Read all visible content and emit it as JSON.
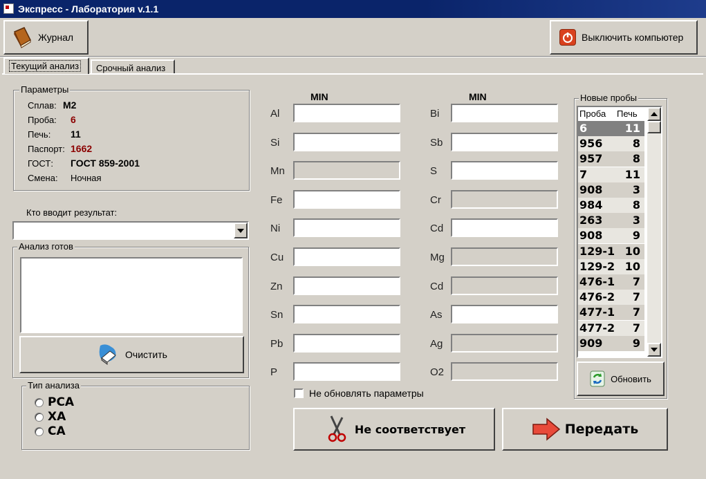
{
  "window": {
    "title": "Экспресс - Лаборатория v.1.1"
  },
  "toolbar": {
    "journal_label": "Журнал",
    "shutdown_label": "Выключить компьютер"
  },
  "tabs": {
    "current": "Текущий анализ",
    "urgent": "Срочный анализ"
  },
  "params": {
    "legend": "Параметры",
    "alloy_label": "Сплав:",
    "alloy_value": "М2",
    "sample_label": "Проба:",
    "sample_value": "6",
    "furnace_label": "Печь:",
    "furnace_value": "11",
    "passport_label": "Паспорт:",
    "passport_value": "1662",
    "gost_label": "ГОСТ:",
    "gost_value": "ГОСТ 859-2001",
    "shift_label": "Смена:",
    "shift_value": "Ночная",
    "accent_color": "#8b0000"
  },
  "operator": {
    "label": "Кто вводит результат:",
    "value": ""
  },
  "ready": {
    "legend": "Анализ готов",
    "text": "",
    "clear_label": "Очистить"
  },
  "analysis_type": {
    "legend": "Тип анализа",
    "options": [
      "РСА",
      "ХА",
      "СА"
    ]
  },
  "elements": {
    "min_header": "MIN",
    "left": [
      {
        "name": "Al",
        "value": "",
        "enabled": true
      },
      {
        "name": "Si",
        "value": "",
        "enabled": true
      },
      {
        "name": "Mn",
        "value": "",
        "enabled": false
      },
      {
        "name": "Fe",
        "value": "",
        "enabled": true
      },
      {
        "name": "Ni",
        "value": "",
        "enabled": true
      },
      {
        "name": "Cu",
        "value": "",
        "enabled": true
      },
      {
        "name": "Zn",
        "value": "",
        "enabled": true
      },
      {
        "name": "Sn",
        "value": "",
        "enabled": true
      },
      {
        "name": "Pb",
        "value": "",
        "enabled": true
      },
      {
        "name": "P",
        "value": "",
        "enabled": true
      }
    ],
    "right": [
      {
        "name": "Bi",
        "value": "",
        "enabled": true
      },
      {
        "name": "Sb",
        "value": "",
        "enabled": true
      },
      {
        "name": "S",
        "value": "",
        "enabled": true
      },
      {
        "name": "Cr",
        "value": "",
        "enabled": false
      },
      {
        "name": "Cd",
        "value": "",
        "enabled": true
      },
      {
        "name": "Mg",
        "value": "",
        "enabled": false
      },
      {
        "name": "Cd",
        "value": "",
        "enabled": false
      },
      {
        "name": "As",
        "value": "",
        "enabled": true
      },
      {
        "name": "Ag",
        "value": "",
        "enabled": false
      },
      {
        "name": "O2",
        "value": "",
        "enabled": false
      }
    ]
  },
  "no_update": {
    "label": "Не обновлять параметры"
  },
  "actions": {
    "mismatch_label": "Не соответствует",
    "send_label": "Передать"
  },
  "new_samples": {
    "legend": "Новые пробы",
    "col_sample": "Проба",
    "col_furnace": "Печь",
    "rows": [
      [
        "6",
        "11"
      ],
      [
        "956",
        "8"
      ],
      [
        "957",
        "8"
      ],
      [
        "7",
        "11"
      ],
      [
        "908",
        "3"
      ],
      [
        "984",
        "8"
      ],
      [
        "263",
        "3"
      ],
      [
        "908",
        "9"
      ],
      [
        "129-1",
        "10"
      ],
      [
        "129-2",
        "10"
      ],
      [
        "476-1",
        "7"
      ],
      [
        "476-2",
        "7"
      ],
      [
        "477-1",
        "7"
      ],
      [
        "477-2",
        "7"
      ],
      [
        "909",
        "9"
      ]
    ],
    "selected_index": 0,
    "refresh_label": "Обновить"
  },
  "icons": [
    "book-icon",
    "power-icon",
    "eraser-icon",
    "scissors-icon",
    "arrow-right-icon",
    "refresh-icon"
  ]
}
